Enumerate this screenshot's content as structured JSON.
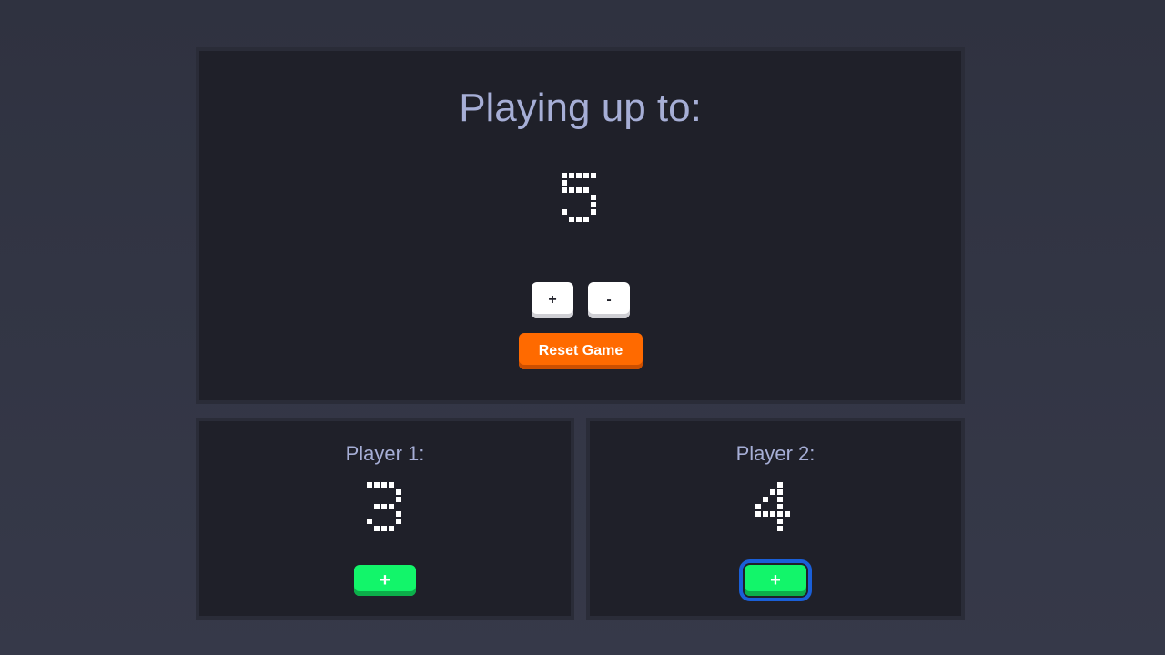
{
  "settings": {
    "heading": "Playing up to:",
    "target_score": 5,
    "increment_label": "+",
    "decrement_label": "-",
    "reset_label": "Reset Game"
  },
  "players": [
    {
      "label": "Player 1:",
      "score": 3,
      "add_label": "+"
    },
    {
      "label": "Player 2:",
      "score": 4,
      "add_label": "+",
      "focused": true
    }
  ],
  "colors": {
    "background": "#33364a",
    "panel": "#1f2029",
    "heading_text": "#a6aed6",
    "reset_button": "#ff6a00",
    "add_button": "#12f56a",
    "focus_ring": "#1a5fd8"
  }
}
